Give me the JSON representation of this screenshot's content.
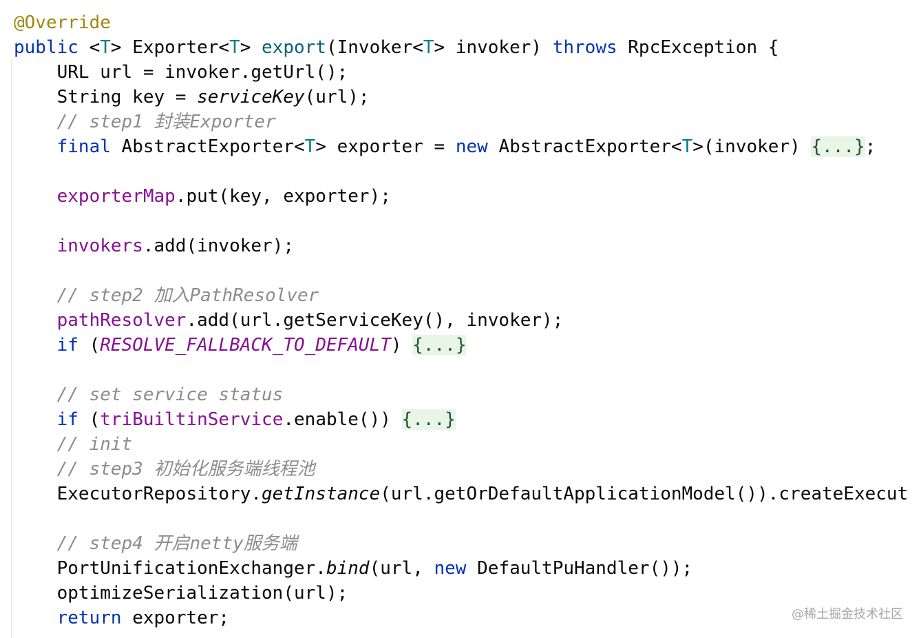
{
  "editor": {
    "lines": [
      {
        "id": "l01",
        "segments": [
          "@Override"
        ]
      },
      {
        "id": "l02",
        "segments": [
          "public",
          " <",
          "T",
          "> Exporter<",
          "T",
          "> ",
          "export",
          "(Invoker<",
          "T",
          "> invoker) ",
          "throws",
          " RpcException {"
        ]
      },
      {
        "id": "l03",
        "segments": [
          "    URL url = invoker.getUrl();"
        ]
      },
      {
        "id": "l04",
        "segments": [
          "    String key = ",
          "serviceKey",
          "(url);"
        ]
      },
      {
        "id": "l05",
        "segments": [
          "    // step1 封装Exporter"
        ]
      },
      {
        "id": "l06",
        "segments": [
          "    ",
          "final",
          " AbstractExporter<",
          "T",
          "> exporter = ",
          "new",
          " AbstractExporter<",
          "T",
          ">(invoker) ",
          "{...}",
          ";"
        ]
      },
      {
        "id": "l07",
        "segments": [
          "    ",
          "exporterMap",
          ".put(key, exporter);"
        ]
      },
      {
        "id": "l08",
        "segments": [
          "    ",
          "invokers",
          ".add(invoker);"
        ]
      },
      {
        "id": "l09",
        "segments": [
          "    // step2 加入PathResolver"
        ]
      },
      {
        "id": "l10",
        "segments": [
          "    ",
          "pathResolver",
          ".add(url.getServiceKey(), invoker);"
        ]
      },
      {
        "id": "l11",
        "segments": [
          "    ",
          "if",
          " (",
          "RESOLVE_FALLBACK_TO_DEFAULT",
          ") ",
          "{...}"
        ]
      },
      {
        "id": "l12",
        "segments": [
          "    // set service status"
        ]
      },
      {
        "id": "l13",
        "segments": [
          "    ",
          "if",
          " (",
          "triBuiltinService",
          ".enable()) ",
          "{...}"
        ]
      },
      {
        "id": "l14",
        "segments": [
          "    // init"
        ]
      },
      {
        "id": "l15",
        "segments": [
          "    // step3 初始化服务端线程池"
        ]
      },
      {
        "id": "l16",
        "segments": [
          "    ExecutorRepository.",
          "getInstance",
          "(url.getOrDefaultApplicationModel()).createExecut"
        ]
      },
      {
        "id": "l17",
        "segments": [
          "    // step4 开启netty服务端"
        ]
      },
      {
        "id": "l18",
        "segments": [
          "    PortUnificationExchanger.",
          "bind",
          "(url, ",
          "new",
          " DefaultPuHandler());"
        ]
      },
      {
        "id": "l19",
        "segments": [
          "    optimizeSerialization(url);"
        ]
      },
      {
        "id": "l20",
        "segments": [
          "    ",
          "return",
          " exporter;"
        ]
      }
    ]
  },
  "watermark": "@稀土掘金技术社区",
  "colors": {
    "keyword": "#0033b3",
    "type_param": "#007e8a",
    "field": "#871094",
    "annotation": "#9e880d",
    "method_decl": "#00627a",
    "comment": "#8c8c8c",
    "fold_background": "#e9f5e6",
    "text": "#080808"
  }
}
